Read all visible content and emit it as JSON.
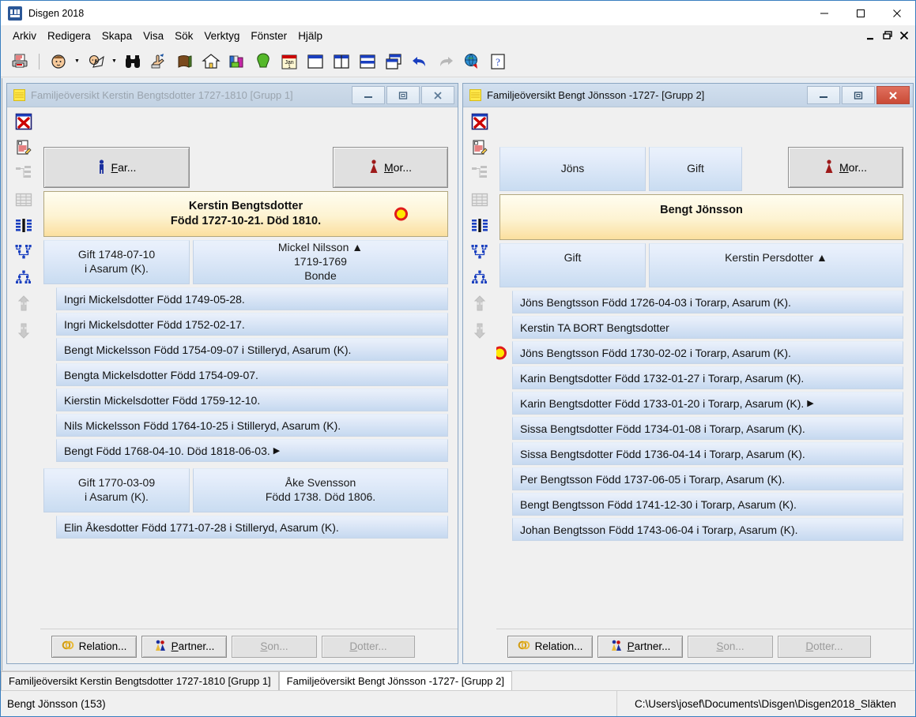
{
  "window": {
    "title": "Disgen 2018",
    "controls": {
      "minimize": "minimize-icon",
      "maximize": "maximize-icon",
      "close": "close-icon"
    }
  },
  "menu": {
    "items": [
      "Arkiv",
      "Redigera",
      "Skapa",
      "Visa",
      "Sök",
      "Verktyg",
      "Fönster",
      "Hjälp"
    ]
  },
  "toolbar": {
    "icons": [
      "print-icon",
      "person-icon",
      "person-dropdown-arrow",
      "person-star-icon",
      "person-star-dropdown-arrow",
      "binoculars-icon",
      "hand-pointer-icon",
      "book-icon",
      "home-icon",
      "books-icon",
      "tree-icon",
      "calendar-icon",
      "window-single-icon",
      "window-split-icon",
      "window-tile-icon",
      "window-cascade-icon",
      "undo-icon",
      "redo-icon",
      "globe-icon",
      "help-icon"
    ]
  },
  "windows": [
    {
      "id": "left",
      "title": "Familjeöversikt Kerstin Bengtsdotter 1727-1810 [Grupp 1]",
      "active": false,
      "rail_icons": [
        "close-red-x-icon",
        "edit-document-icon",
        "tree-chart-icon",
        "table-chart-icon",
        "columns-icon",
        "descendant-chart-icon",
        "ancestor-chart-icon",
        "move-up-icon",
        "move-down-icon"
      ],
      "father_button": {
        "label": "Far...",
        "accel": "F",
        "icon": "male-figure-icon"
      },
      "mother_button": {
        "label": "Mor...",
        "accel": "M",
        "icon": "female-figure-icon"
      },
      "person": {
        "name": "Kerstin Bengtsdotter",
        "detail": "Född 1727-10-21. Död 1810.",
        "marker": true
      },
      "families": [
        {
          "marriage": "Gift 1748-07-10\ni  Asarum (K).",
          "marriage_lines": [
            "Gift 1748-07-10",
            "i  Asarum (K)."
          ],
          "partner_lines": [
            "Mickel Nilsson ▲",
            "1719-1769",
            "Bonde"
          ],
          "children": [
            {
              "text": "Ingri Mickelsdotter Född 1749-05-28.",
              "more": false,
              "marker": false
            },
            {
              "text": "Ingri Mickelsdotter Född 1752-02-17.",
              "more": false,
              "marker": false
            },
            {
              "text": "Bengt Mickelsson Född 1754-09-07 i Stilleryd, Asarum (K).",
              "more": false,
              "marker": false
            },
            {
              "text": "Bengta Mickelsdotter Född 1754-09-07.",
              "more": false,
              "marker": false
            },
            {
              "text": "Kierstin Mickelsdotter Född 1759-12-10.",
              "more": false,
              "marker": false
            },
            {
              "text": "Nils Mickelsson Född 1764-10-25 i Stilleryd, Asarum (K).",
              "more": false,
              "marker": false
            },
            {
              "text": "Bengt  Född 1768-04-10. Död 1818-06-03.",
              "more": true,
              "marker": false
            }
          ]
        },
        {
          "marriage_lines": [
            "Gift 1770-03-09",
            "i  Asarum (K)."
          ],
          "partner_lines": [
            "Åke Svensson",
            "Född 1738. Död 1806."
          ],
          "children": [
            {
              "text": "Elin Åkesdotter Född 1771-07-28 i Stilleryd, Asarum (K).",
              "more": false,
              "marker": false
            }
          ]
        }
      ],
      "buttons": [
        {
          "label": "Relation...",
          "accel": "",
          "icon": "rings-icon",
          "disabled": false
        },
        {
          "label": "Partner...",
          "accel": "P",
          "icon": "couple-icon",
          "disabled": false
        },
        {
          "label": "Son...",
          "accel": "S",
          "icon": "",
          "disabled": true
        },
        {
          "label": "Dotter...",
          "accel": "D",
          "icon": "",
          "disabled": true
        }
      ]
    },
    {
      "id": "right",
      "title": "Familjeöversikt Bengt Jönsson -1727- [Grupp 2]",
      "active": true,
      "rail_icons": [
        "close-red-x-icon",
        "edit-document-icon",
        "tree-chart-icon",
        "table-chart-icon",
        "columns-icon",
        "descendant-chart-icon",
        "ancestor-chart-icon",
        "move-up-icon",
        "move-down-icon"
      ],
      "father_box": "Jöns",
      "parent_marriage_box": "Gift",
      "mother_button": {
        "label": "Mor...",
        "accel": "M",
        "icon": "female-figure-icon"
      },
      "person": {
        "name": "Bengt Jönsson",
        "detail": "",
        "marker": false
      },
      "families": [
        {
          "marriage_lines": [
            "Gift"
          ],
          "partner_lines": [
            "Kerstin Persdotter ▲"
          ],
          "children": [
            {
              "text": "Jöns Bengtsson Född 1726-04-03 i Torarp, Asarum (K).",
              "more": false,
              "marker": false
            },
            {
              "text": "Kerstin TA BORT Bengtsdotter",
              "more": false,
              "marker": false
            },
            {
              "text": "Jöns Bengtsson Född 1730-02-02 i Torarp, Asarum (K).",
              "more": false,
              "marker": true
            },
            {
              "text": "Karin Bengtsdotter Född 1732-01-27 i Torarp, Asarum (K).",
              "more": false,
              "marker": false
            },
            {
              "text": "Karin Bengtsdotter Född 1733-01-20 i Torarp, Asarum (K).",
              "more": true,
              "marker": false
            },
            {
              "text": "Sissa Bengtsdotter Född 1734-01-08 i Torarp, Asarum (K).",
              "more": false,
              "marker": false
            },
            {
              "text": "Sissa Bengtsdotter Född 1736-04-14 i Torarp, Asarum (K).",
              "more": false,
              "marker": false
            },
            {
              "text": "Per Bengtsson Född 1737-06-05 i Torarp, Asarum (K).",
              "more": false,
              "marker": false
            },
            {
              "text": "Bengt Bengtsson Född 1741-12-30 i Torarp, Asarum (K).",
              "more": false,
              "marker": false
            },
            {
              "text": "Johan Bengtsson Född 1743-06-04 i Torarp, Asarum (K).",
              "more": false,
              "marker": false
            }
          ]
        }
      ],
      "buttons": [
        {
          "label": "Relation...",
          "accel": "",
          "icon": "rings-icon",
          "disabled": false
        },
        {
          "label": "Partner...",
          "accel": "P",
          "icon": "couple-icon",
          "disabled": false
        },
        {
          "label": "Son...",
          "accel": "S",
          "icon": "",
          "disabled": true
        },
        {
          "label": "Dotter...",
          "accel": "D",
          "icon": "",
          "disabled": true
        }
      ]
    }
  ],
  "tabs": [
    {
      "label": "Familjeöversikt Kerstin Bengtsdotter 1727-1810 [Grupp 1]",
      "active": false
    },
    {
      "label": "Familjeöversikt Bengt Jönsson -1727- [Grupp 2]",
      "active": true
    }
  ],
  "statusbar": {
    "left": "Bengt Jönsson  (153)",
    "right": "C:\\Users\\josef\\Documents\\Disgen\\Disgen2018_Släkten"
  },
  "colors": {
    "accent": "#2b5797",
    "person_box": "#fbdf9e",
    "child_box": "#c6d9f0",
    "marker_fill": "#ffe800",
    "marker_ring": "#e01b1b",
    "close_active": "#c94a36"
  }
}
